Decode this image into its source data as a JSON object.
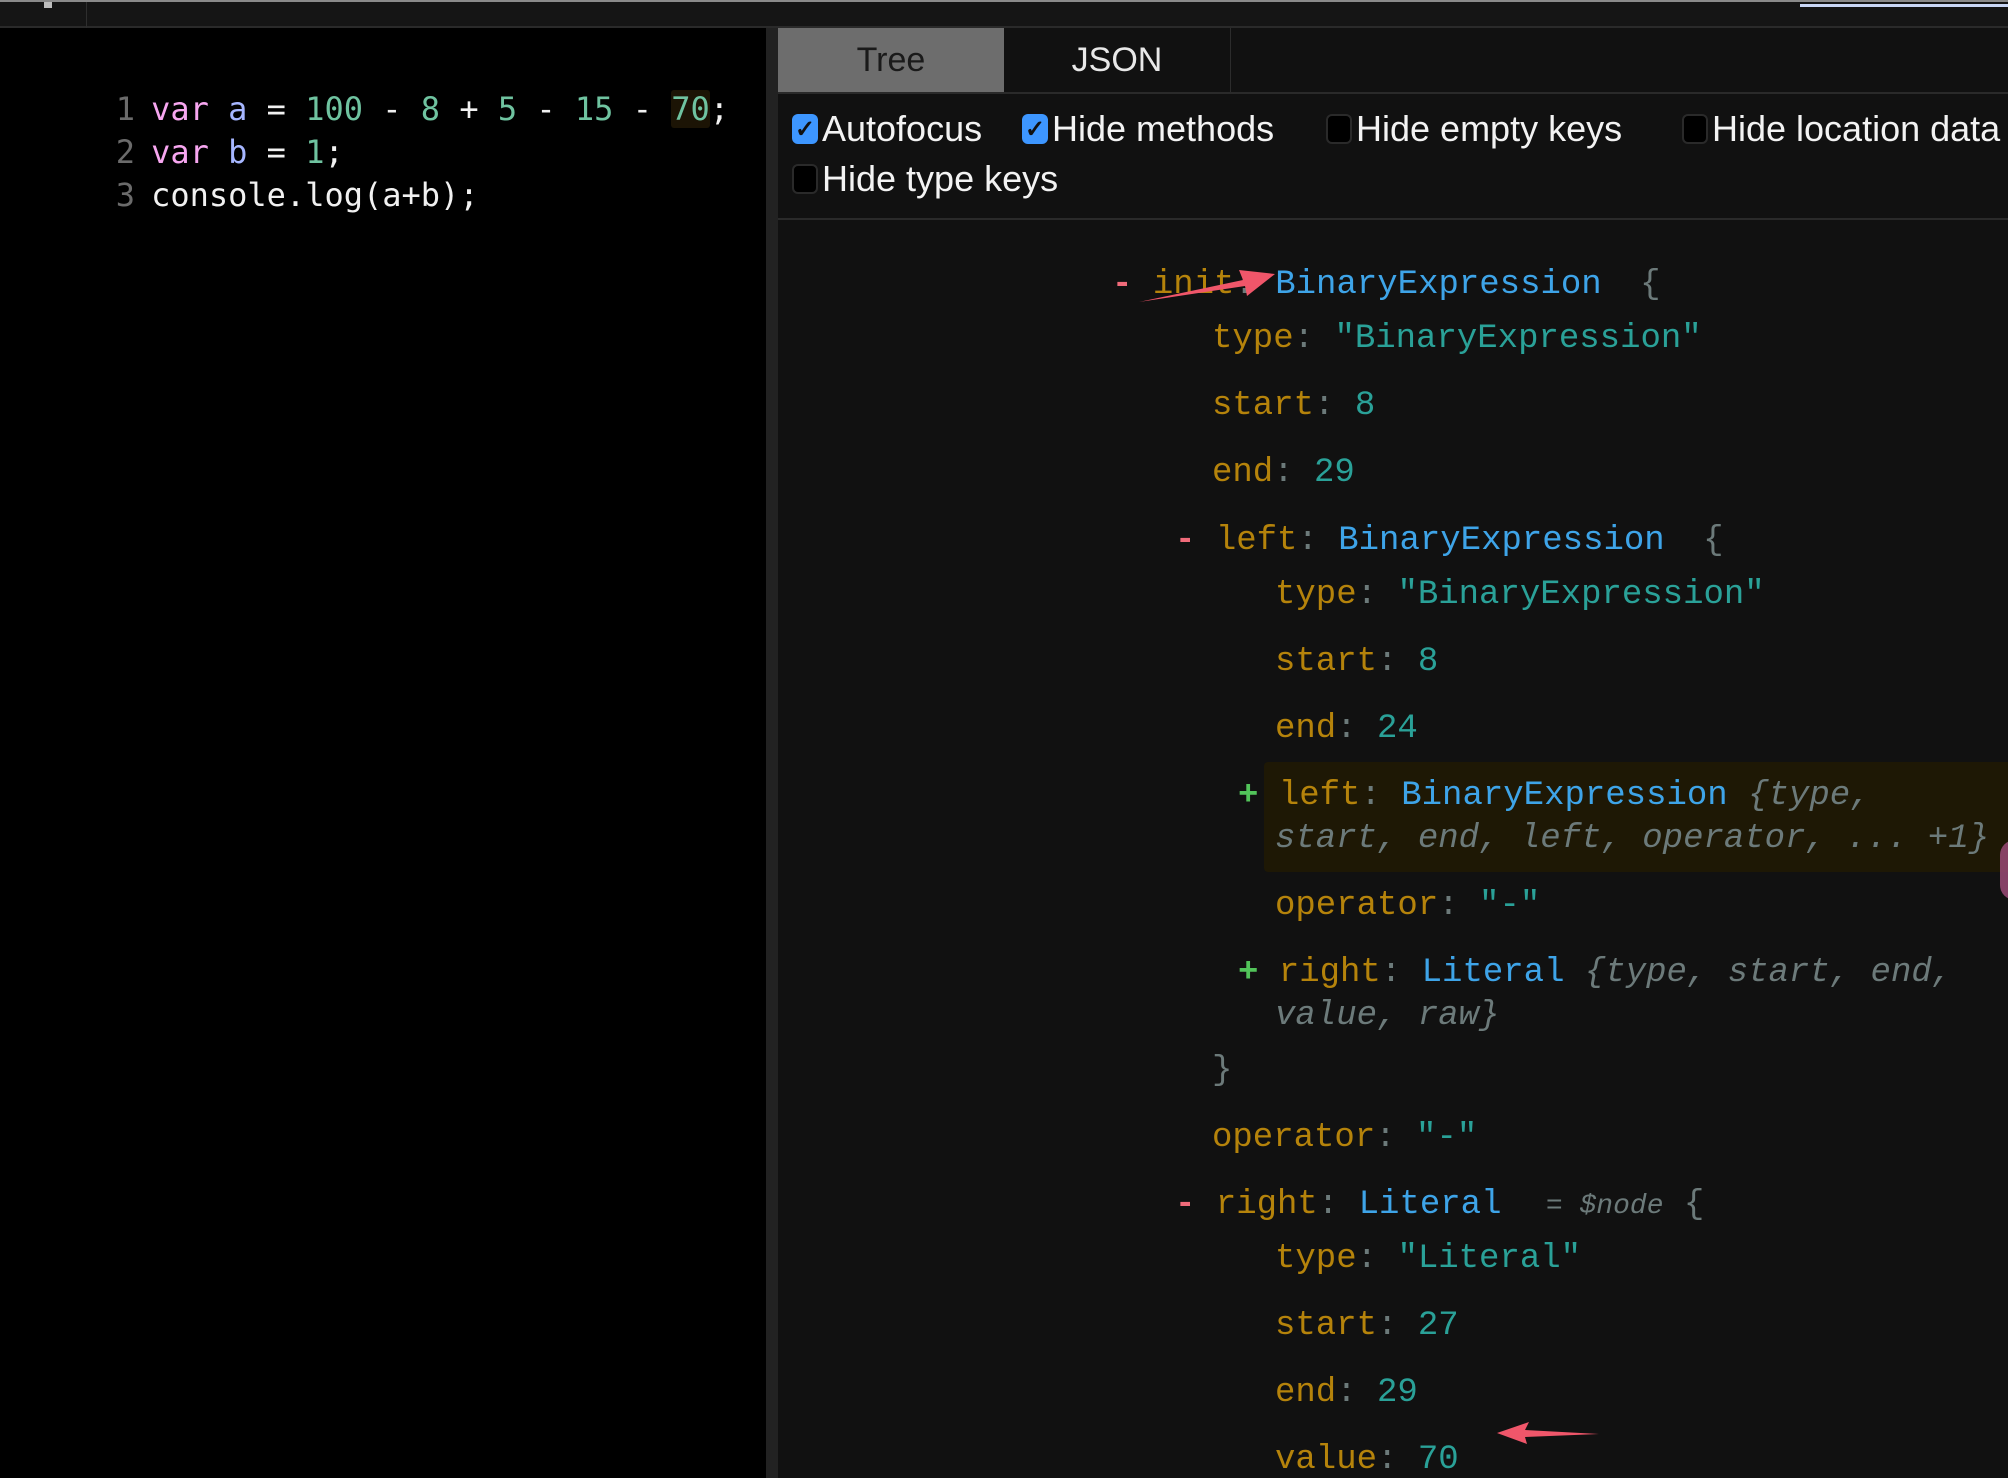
{
  "editor": {
    "lines": [
      {
        "num": "1",
        "tokens": [
          {
            "t": "var",
            "c": "kw"
          },
          {
            "t": " ",
            "c": "plain"
          },
          {
            "t": "a",
            "c": "var"
          },
          {
            "t": " = ",
            "c": "plain"
          },
          {
            "t": "100",
            "c": "num"
          },
          {
            "t": " - ",
            "c": "plain"
          },
          {
            "t": "8",
            "c": "num"
          },
          {
            "t": " + ",
            "c": "plain"
          },
          {
            "t": "5",
            "c": "num"
          },
          {
            "t": " - ",
            "c": "plain"
          },
          {
            "t": "15",
            "c": "num"
          },
          {
            "t": " - ",
            "c": "plain"
          },
          {
            "t": "70",
            "c": "num-hl"
          },
          {
            "t": ";",
            "c": "plain"
          }
        ]
      },
      {
        "num": "2",
        "tokens": [
          {
            "t": "var",
            "c": "kw"
          },
          {
            "t": " ",
            "c": "plain"
          },
          {
            "t": "b",
            "c": "var"
          },
          {
            "t": " = ",
            "c": "plain"
          },
          {
            "t": "1",
            "c": "num"
          },
          {
            "t": ";",
            "c": "plain"
          }
        ]
      },
      {
        "num": "3",
        "tokens": [
          {
            "t": "console.log(a+b);",
            "c": "plain"
          }
        ]
      }
    ]
  },
  "tabs": [
    {
      "label": "Tree",
      "active": true
    },
    {
      "label": "JSON",
      "active": false
    }
  ],
  "options": [
    {
      "label": "Autofocus",
      "checked": true
    },
    {
      "label": "Hide methods",
      "checked": true
    },
    {
      "label": "Hide empty keys",
      "checked": false
    },
    {
      "label": "Hide location data",
      "checked": false
    },
    {
      "label": "Hide type keys",
      "checked": false
    }
  ],
  "tree": {
    "init": {
      "toggle": "-",
      "key": "init",
      "type": "BinaryExpression",
      "brace": "{"
    },
    "init_type": {
      "key": "type",
      "value": "\"BinaryExpression\""
    },
    "init_start": {
      "key": "start",
      "value": "8"
    },
    "init_end": {
      "key": "end",
      "value": "29"
    },
    "left": {
      "toggle": "-",
      "key": "left",
      "type": "BinaryExpression",
      "brace": "{"
    },
    "left_type": {
      "key": "type",
      "value": "\"BinaryExpression\""
    },
    "left_start": {
      "key": "start",
      "value": "8"
    },
    "left_end": {
      "key": "end",
      "value": "24"
    },
    "left_left": {
      "toggle": "+",
      "key": "left",
      "type": "BinaryExpression",
      "summary_line1": "{type,",
      "summary_line2": "start, end, left, operator, ... +1}"
    },
    "left_operator": {
      "key": "operator",
      "value": "\"-\""
    },
    "left_right": {
      "toggle": "+",
      "key": "right",
      "type": "Literal",
      "summary_line1": "{type, start, end,",
      "summary_line2": "value, raw}"
    },
    "left_close": "}",
    "init_operator": {
      "key": "operator",
      "value": "\"-\""
    },
    "right": {
      "toggle": "-",
      "key": "right",
      "type": "Literal",
      "annotation": "= $node",
      "brace": "{"
    },
    "right_type": {
      "key": "type",
      "value": "\"Literal\""
    },
    "right_start": {
      "key": "start",
      "value": "27"
    },
    "right_end": {
      "key": "end",
      "value": "29"
    },
    "right_value": {
      "key": "value",
      "value": "70"
    }
  },
  "colors": {
    "accent_checkbox": "#3d96ff",
    "annotation_arrow": "#f0566a",
    "tree_key": "#b5830b",
    "tree_type": "#3ea4e8",
    "tree_value": "#2aa198"
  }
}
